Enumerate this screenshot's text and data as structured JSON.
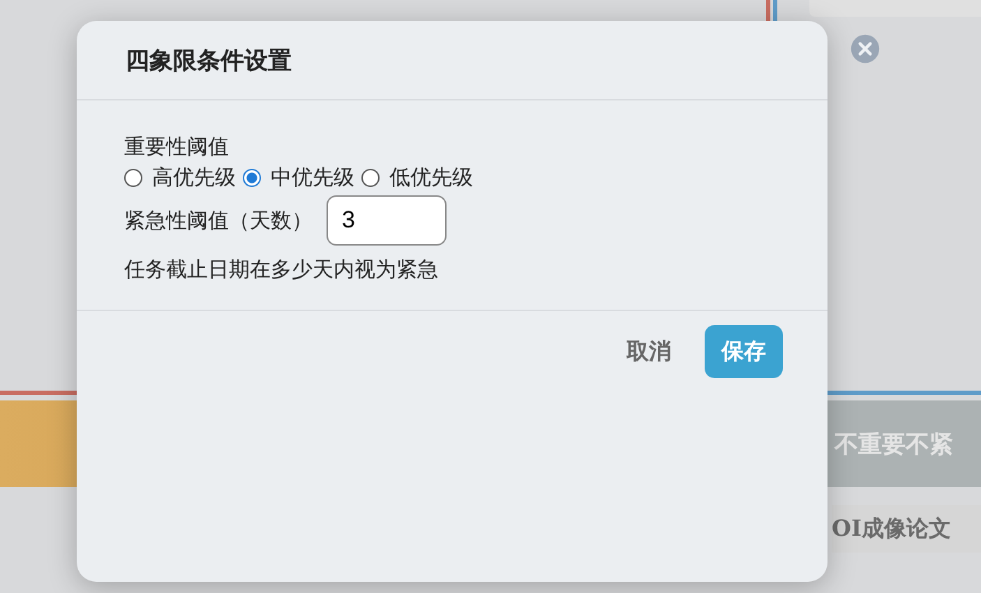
{
  "background": {
    "quadrant_header": "不重要不紧",
    "task_title": "OI成像论文"
  },
  "dialog": {
    "title": "四象限条件设置",
    "importance_label": "重要性阈值",
    "importance_options": [
      {
        "label": "高优先级",
        "selected": false
      },
      {
        "label": "中优先级",
        "selected": true
      },
      {
        "label": "低优先级",
        "selected": false
      }
    ],
    "urgency_label": "紧急性阈值（天数）",
    "urgency_value": "3",
    "urgency_hint": "任务截止日期在多少天内视为紧急",
    "buttons": [
      {
        "label": "取消",
        "kind": "secondary"
      },
      {
        "label": "保存",
        "kind": "primary"
      }
    ]
  }
}
